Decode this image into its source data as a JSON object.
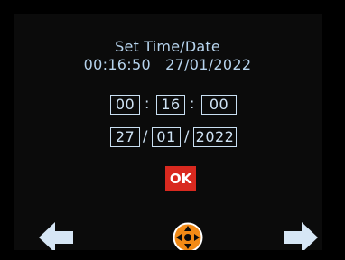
{
  "screen": {
    "title": "Set Time/Date",
    "current_time": "00:16:50",
    "current_date": "27/01/2022"
  },
  "time_fields": {
    "hours": "00",
    "minutes": "16",
    "seconds": "00",
    "separator": ":"
  },
  "date_fields": {
    "day": "27",
    "month": "01",
    "year": "2022",
    "separator": "/"
  },
  "buttons": {
    "ok_label": "OK"
  },
  "icons": {
    "left": "arrow-left-icon",
    "right": "arrow-right-icon",
    "dpad": "directional-pad-icon"
  },
  "colors": {
    "text": "#b7d4ee",
    "ok_background": "#d9291f",
    "arrow": "#d6e6f5",
    "dpad_accent": "#f28a16"
  }
}
